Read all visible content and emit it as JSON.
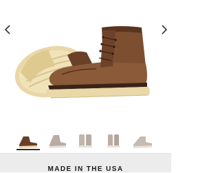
{
  "gallery": {
    "prev_icon": "chevron-left-icon",
    "next_icon": "chevron-right-icon",
    "hero_image": "boot-pair-image",
    "colors": {
      "leather": "#7a4a2e",
      "leather_dark": "#4a2a18",
      "sole": "#e8d6a6",
      "welt": "#3a2418"
    }
  },
  "thumbnails": [
    {
      "name": "thumb-pair",
      "tone": "#6a3f27",
      "active": true
    },
    {
      "name": "thumb-side",
      "tone": "#b9aca4",
      "active": false
    },
    {
      "name": "thumb-front",
      "tone": "#c3b6ad",
      "active": false
    },
    {
      "name": "thumb-back",
      "tone": "#bcaea5",
      "active": false
    },
    {
      "name": "thumb-angle",
      "tone": "#c6bab1",
      "active": false
    }
  ],
  "footer": {
    "made_in_label": "MADE IN THE USA"
  }
}
